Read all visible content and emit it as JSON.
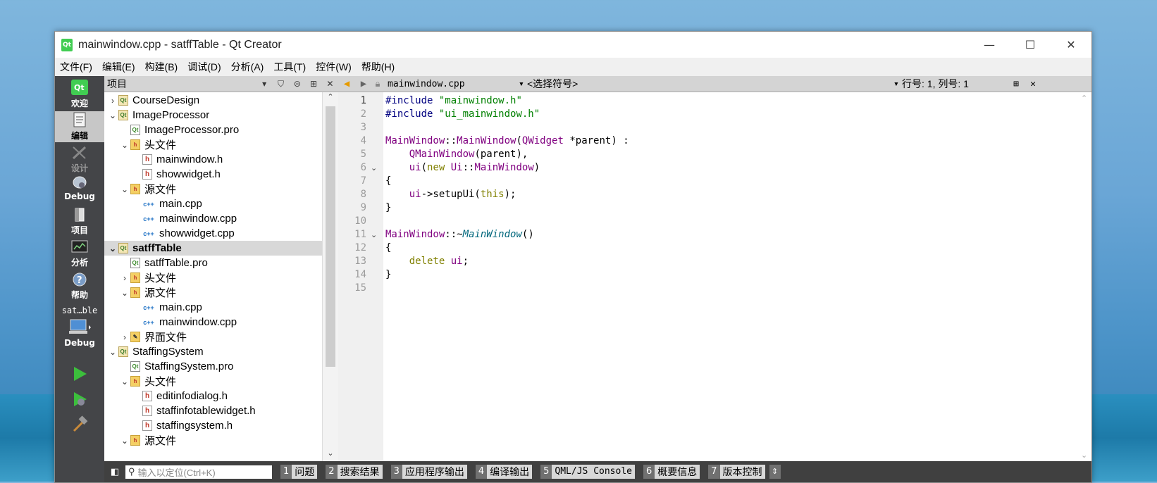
{
  "window": {
    "title": "mainwindow.cpp - satffTable - Qt Creator",
    "minimize": "—",
    "maximize": "☐",
    "close": "✕"
  },
  "menu": [
    "文件(F)",
    "编辑(E)",
    "构建(B)",
    "调试(D)",
    "分析(A)",
    "工具(T)",
    "控件(W)",
    "帮助(H)"
  ],
  "modes": {
    "welcome": "欢迎",
    "edit": "编辑",
    "design": "设计",
    "debug": "Debug",
    "projects": "项目",
    "analyze": "分析",
    "help": "帮助",
    "kit_project": "sat…ble",
    "kit_build": "Debug"
  },
  "project_panel": {
    "title": "项目",
    "tree": [
      {
        "label": "CourseDesign",
        "depth": 0,
        "arrow": "›",
        "icon": "proj"
      },
      {
        "label": "ImageProcessor",
        "depth": 0,
        "arrow": "⌄",
        "icon": "proj"
      },
      {
        "label": "ImageProcessor.pro",
        "depth": 1,
        "arrow": "",
        "icon": "pro"
      },
      {
        "label": "头文件",
        "depth": 1,
        "arrow": "⌄",
        "icon": "folder"
      },
      {
        "label": "mainwindow.h",
        "depth": 2,
        "arrow": "",
        "icon": "h"
      },
      {
        "label": "showwidget.h",
        "depth": 2,
        "arrow": "",
        "icon": "h"
      },
      {
        "label": "源文件",
        "depth": 1,
        "arrow": "⌄",
        "icon": "folder"
      },
      {
        "label": "main.cpp",
        "depth": 2,
        "arrow": "",
        "icon": "cpp"
      },
      {
        "label": "mainwindow.cpp",
        "depth": 2,
        "arrow": "",
        "icon": "cpp"
      },
      {
        "label": "showwidget.cpp",
        "depth": 2,
        "arrow": "",
        "icon": "cpp"
      },
      {
        "label": "satffTable",
        "depth": 0,
        "arrow": "⌄",
        "icon": "proj",
        "selected": true
      },
      {
        "label": "satffTable.pro",
        "depth": 1,
        "arrow": "",
        "icon": "pro"
      },
      {
        "label": "头文件",
        "depth": 1,
        "arrow": "›",
        "icon": "folder"
      },
      {
        "label": "源文件",
        "depth": 1,
        "arrow": "⌄",
        "icon": "folder"
      },
      {
        "label": "main.cpp",
        "depth": 2,
        "arrow": "",
        "icon": "cpp"
      },
      {
        "label": "mainwindow.cpp",
        "depth": 2,
        "arrow": "",
        "icon": "cpp"
      },
      {
        "label": "界面文件",
        "depth": 1,
        "arrow": "›",
        "icon": "ui"
      },
      {
        "label": "StaffingSystem",
        "depth": 0,
        "arrow": "⌄",
        "icon": "proj"
      },
      {
        "label": "StaffingSystem.pro",
        "depth": 1,
        "arrow": "",
        "icon": "pro"
      },
      {
        "label": "头文件",
        "depth": 1,
        "arrow": "⌄",
        "icon": "folder"
      },
      {
        "label": "editinfodialog.h",
        "depth": 2,
        "arrow": "",
        "icon": "h"
      },
      {
        "label": "staffinfotablewidget.h",
        "depth": 2,
        "arrow": "",
        "icon": "h"
      },
      {
        "label": "staffingsystem.h",
        "depth": 2,
        "arrow": "",
        "icon": "h"
      },
      {
        "label": "源文件",
        "depth": 1,
        "arrow": "⌄",
        "icon": "folder"
      }
    ]
  },
  "editor": {
    "file": "mainwindow.cpp",
    "symbol": "<选择符号>",
    "position": "行号: 1, 列号: 1",
    "lines": [
      "<span class=\"pp\">#include</span> <span class=\"str\">\"mainwindow.h\"</span>",
      "<span class=\"pp\">#include</span> <span class=\"str\">\"ui_mainwindow.h\"</span>",
      "",
      "<span class=\"ty\">MainWindow</span>::<span class=\"ty\">MainWindow</span>(<span class=\"ty\">QWidget</span> *parent) :",
      "    <span class=\"ty\">QMainWindow</span>(parent),",
      "    <span class=\"ty\">ui</span>(<span class=\"kw\">new</span> <span class=\"ty\">Ui</span>::<span class=\"ty\">MainWindow</span>)",
      "{",
      "    <span class=\"ty\">ui</span>->setupUi(<span class=\"kw\">this</span>);",
      "}",
      "",
      "<span class=\"ty\">MainWindow</span>::~<span class=\"it\">MainWindow</span>()",
      "{",
      "    <span class=\"kw\">delete</span> <span class=\"ty\">ui</span>;",
      "}",
      ""
    ],
    "fold_lines": [
      6,
      11
    ]
  },
  "statusbar": {
    "locator_placeholder": "输入以定位(Ctrl+K)",
    "panes": [
      {
        "n": "1",
        "label": "问题"
      },
      {
        "n": "2",
        "label": "搜索结果"
      },
      {
        "n": "3",
        "label": "应用程序输出"
      },
      {
        "n": "4",
        "label": "编译输出"
      },
      {
        "n": "5",
        "label": "QML/JS Console",
        "mono": true
      },
      {
        "n": "6",
        "label": "概要信息"
      },
      {
        "n": "7",
        "label": "版本控制"
      }
    ]
  }
}
